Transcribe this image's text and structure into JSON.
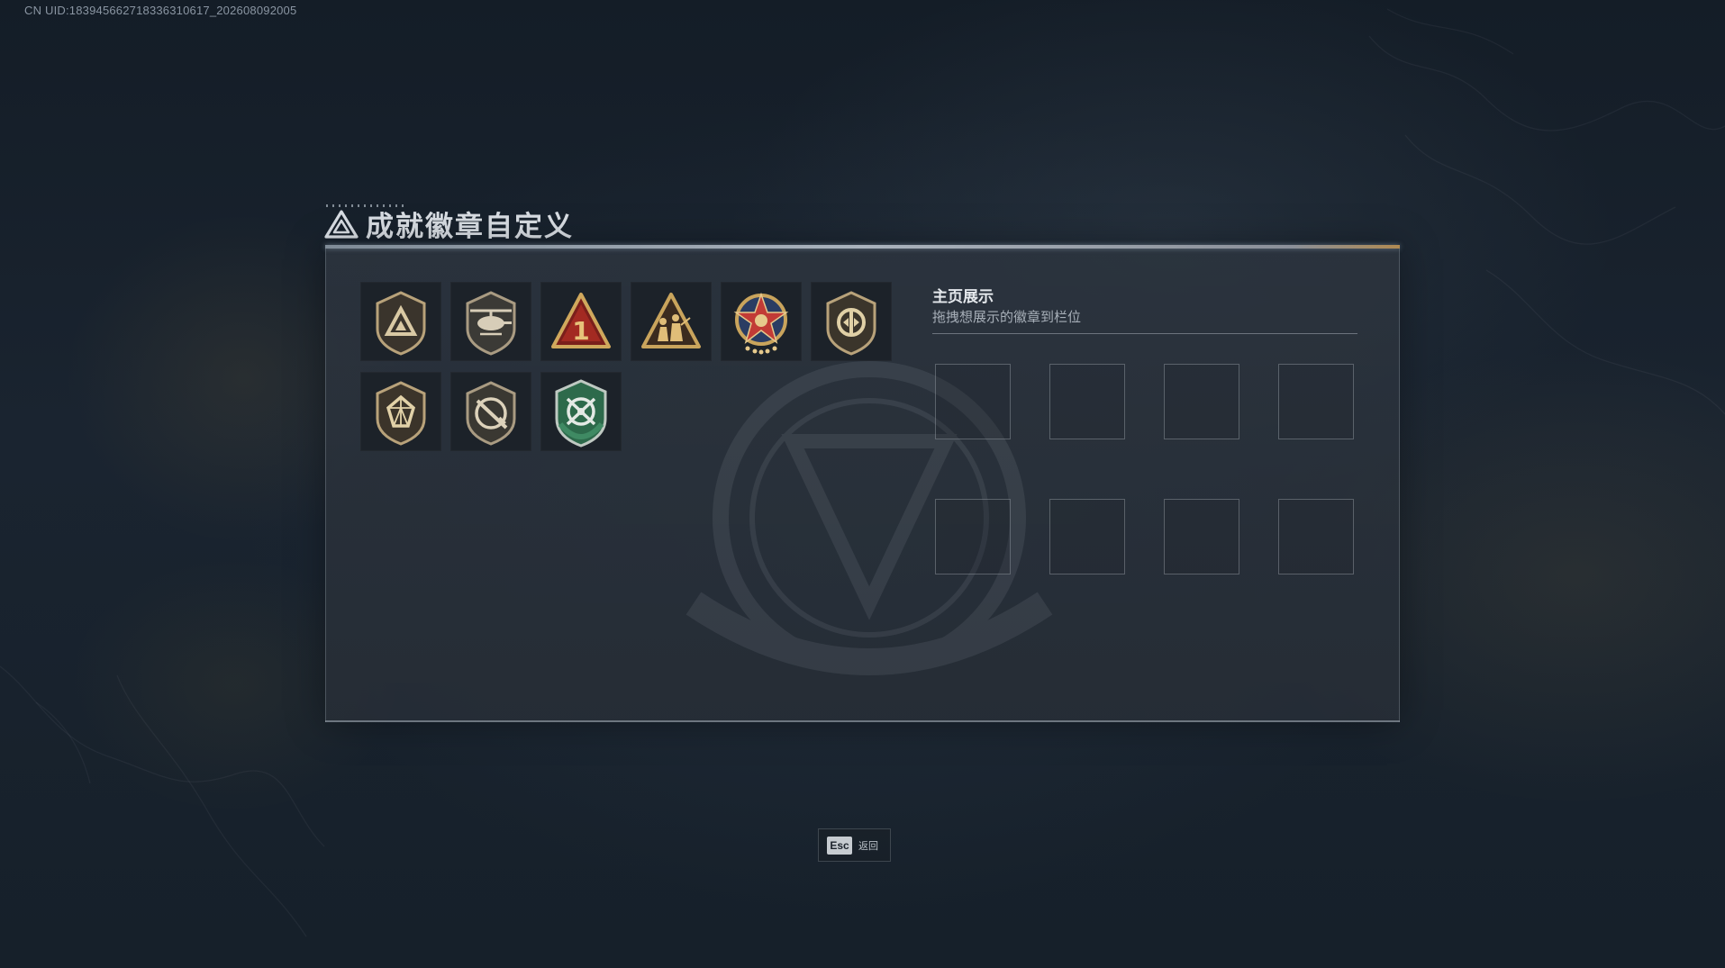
{
  "uid_text": "CN UID:1839456627183363106​17_202608092005",
  "header": {
    "title": "成就徽章自定义",
    "icon": "triangle-emblem-icon"
  },
  "badges": [
    {
      "name": "badge-shield-triangle",
      "icon": "shield-triangle-icon",
      "accent": "#b8a27a"
    },
    {
      "name": "badge-helicopter",
      "icon": "helicopter-icon",
      "accent": "#a99b82"
    },
    {
      "name": "badge-rank-one",
      "icon": "triangle-number-one-icon",
      "accent": "#c9a45c"
    },
    {
      "name": "badge-soldiers",
      "icon": "triangle-soldiers-icon",
      "accent": "#c9a45c"
    },
    {
      "name": "badge-star-medal",
      "icon": "star-medal-icon",
      "accent": "#c23b36"
    },
    {
      "name": "badge-shield-round",
      "icon": "shield-round-emblem-icon",
      "accent": "#b8a27a"
    },
    {
      "name": "badge-shield-gem",
      "icon": "shield-gem-icon",
      "accent": "#b8a27a"
    },
    {
      "name": "badge-shield-rifle",
      "icon": "shield-rifle-icon",
      "accent": "#a99b82"
    },
    {
      "name": "badge-shield-green-cross",
      "icon": "shield-green-crossed-icon",
      "accent": "#3f8a63"
    }
  ],
  "showcase": {
    "title": "主页展示",
    "subtitle": "拖拽想展示的徽章到栏位",
    "slot_count": 8
  },
  "footer": {
    "key": "Esc",
    "label": "返回"
  }
}
